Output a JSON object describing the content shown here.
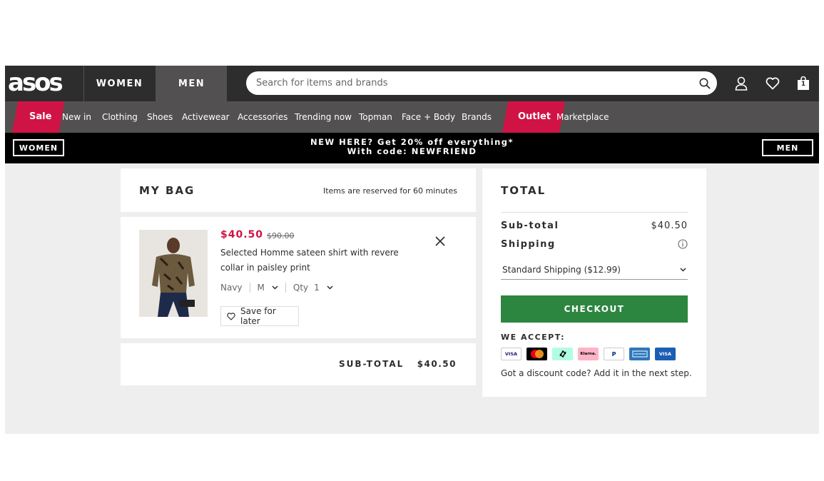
{
  "header": {
    "logo": "asos",
    "gender_tabs": [
      {
        "label": "WOMEN",
        "active": false
      },
      {
        "label": "MEN",
        "active": true
      }
    ],
    "search_placeholder": "Search for items and brands",
    "icons": [
      "search-icon",
      "account-icon",
      "heart-icon",
      "bag-icon"
    ],
    "bag_count": "1"
  },
  "categories": [
    {
      "label": "Sale",
      "highlight": true
    },
    {
      "label": "New in"
    },
    {
      "label": "Clothing"
    },
    {
      "label": "Shoes"
    },
    {
      "label": "Activewear"
    },
    {
      "label": "Accessories"
    },
    {
      "label": "Trending now"
    },
    {
      "label": "Topman"
    },
    {
      "label": "Face + Body"
    },
    {
      "label": "Brands"
    },
    {
      "label": "Outlet",
      "highlight": true
    },
    {
      "label": "Marketplace"
    }
  ],
  "promo": {
    "women_label": "WOMEN",
    "men_label": "MEN",
    "line1": "NEW HERE? Get 20% off everything*",
    "line2": "With code: NEWFRIEND"
  },
  "bag": {
    "title": "MY BAG",
    "reserved_note": "Items are reserved for 60 minutes",
    "items": [
      {
        "price_now": "$40.50",
        "price_was": "$90.00",
        "description": "Selected Homme sateen shirt with revere collar in paisley print",
        "colour": "Navy",
        "size": "M",
        "qty_label": "Qty",
        "qty": "1",
        "save_label": "Save for later"
      }
    ],
    "subtotal_label": "SUB-TOTAL",
    "subtotal_value": "$40.50"
  },
  "total": {
    "title": "TOTAL",
    "subtotal_label": "Sub-total",
    "subtotal_value": "$40.50",
    "shipping_label": "Shipping",
    "shipping_option": "Standard Shipping ($12.99)",
    "checkout_label": "CHECKOUT",
    "accept_label": "WE ACCEPT:",
    "payment_methods": [
      "VISA",
      "Mastercard",
      "Afterpay",
      "Klarna",
      "PayPal",
      "American Express",
      "Visa Electron"
    ],
    "discount_note": "Got a discount code? Add it in the next step."
  },
  "colors": {
    "header_dark": "#2d2d2d",
    "nav_grey": "#525050",
    "sale_red": "#d01345",
    "checkout_green": "#2c8640",
    "page_bg": "#eeeeee"
  }
}
